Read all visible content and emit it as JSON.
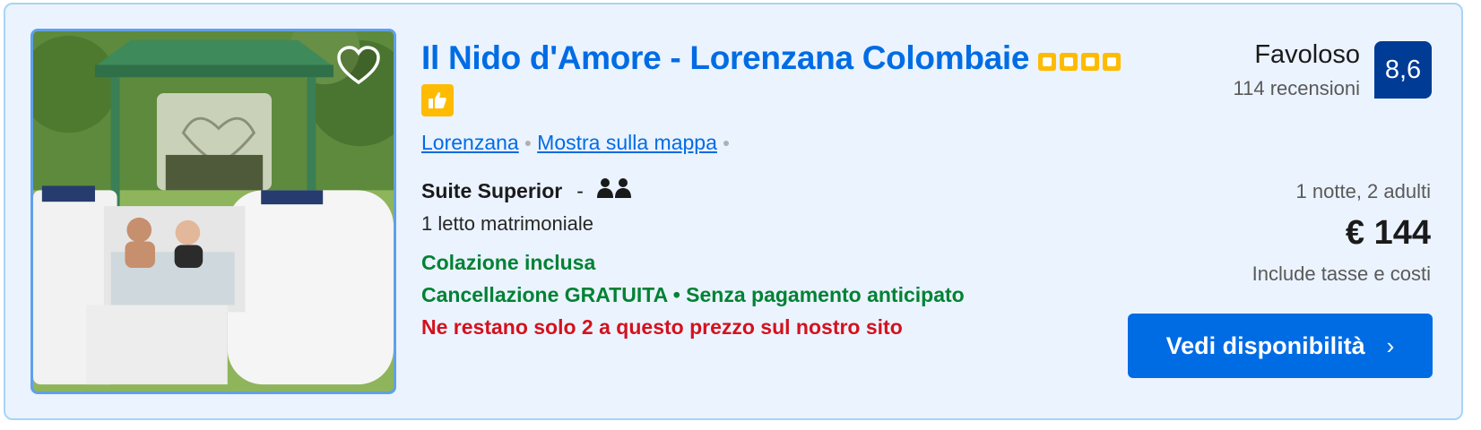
{
  "property": {
    "name": "Il Nido d'Amore - Lorenzana Colombaie",
    "star_rating": 4,
    "location_link": "Lorenzana",
    "map_link": "Mostra sulla mappa"
  },
  "rating": {
    "word": "Favoloso",
    "reviews": "114 recensioni",
    "score": "8,6"
  },
  "room": {
    "name": "Suite Superior",
    "separator": "-",
    "bed": "1 letto matrimoniale",
    "breakfast": "Colazione inclusa",
    "cancellation": "Cancellazione GRATUITA • Senza pagamento anticipato",
    "scarcity": "Ne restano solo 2 a questo prezzo sul nostro sito"
  },
  "pricing": {
    "stay": "1 notte, 2 adulti",
    "price": "€ 144",
    "taxes_note": "Include tasse e costi"
  },
  "cta": {
    "label": "Vedi disponibilità",
    "chevron": "›"
  },
  "icons": {
    "favorite": "heart-icon",
    "preferred": "thumbs-up-icon",
    "occupancy": "two-persons-icon",
    "chevron": "chevron-right-icon"
  },
  "colors": {
    "primary": "#006ce4",
    "rating_badge": "#003b95",
    "star": "#febb02",
    "green": "#008234",
    "red": "#d4111e",
    "card_bg": "#ebf3ff"
  }
}
